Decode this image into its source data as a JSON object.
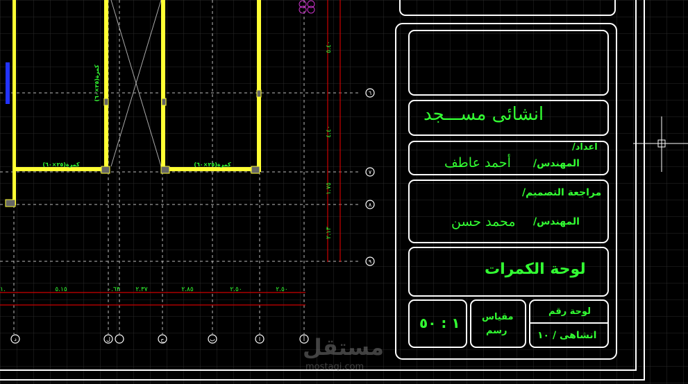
{
  "title_block": {
    "project": "انشائى مســـجد",
    "prepared_label": "اعداد/",
    "engineer_prefix_1": "المهندس/",
    "engineer_name_1": "أحمد عاطف",
    "review_label": "مراجعة التصميم/",
    "engineer_prefix_2": "المهندس/",
    "engineer_name_2": "محمد حسن",
    "sheet_title": "لوحة الكمرات",
    "scale_value": "١ : ٥٠",
    "scale_label_1": "مقياس",
    "scale_label_2": "رسم",
    "sheet_no_label": "لوحة رقم",
    "sheet_no_value": "انشاهى / ١٠"
  },
  "grid_bubbles_right": [
    "٦",
    "٧",
    "٨",
    "٩"
  ],
  "grid_bubbles_bottom": [
    "د",
    "ل",
    "ح",
    "ب",
    "ا",
    "أ"
  ],
  "vertical_dims": [
    "٥.٤٠",
    "٤.٤٠",
    "١.٧٥",
    "٢.١٣"
  ],
  "horizontal_dims": [
    "١.",
    "٥.١٥",
    "٠.٦٣",
    "٢.٣٧",
    "٢.٨٥",
    "٢.٥٠",
    "٢.٥٠"
  ],
  "beam_labels": [
    "كمرة(٢٥×٦٠)",
    "كمرة(٢٥×٦٠)",
    "كمرة(٢٥×٦٠)"
  ],
  "watermark": {
    "arabic": "مستقل",
    "latin": "mostaqi.com"
  },
  "colors": {
    "bg": "#000000",
    "cad_green": "#33ff33",
    "beam_yellow": "#ffff33",
    "grid": "#3a3a3a",
    "dim_red": "#cc0000",
    "frame_white": "#ffffff"
  }
}
